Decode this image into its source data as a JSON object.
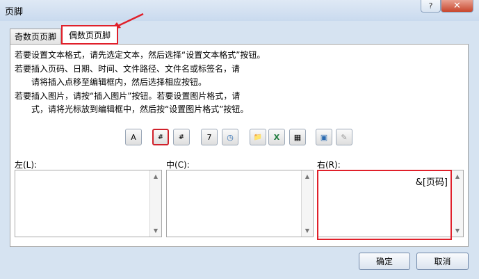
{
  "window": {
    "title": "页脚",
    "help": "?",
    "close": "✕"
  },
  "tabs": [
    {
      "label": "奇数页页脚"
    },
    {
      "label": "偶数页页脚"
    }
  ],
  "instructions": [
    "若要设置文本格式，请先选定文本，然后选择“设置文本格式”按钮。",
    "若要插入页码、日期、时间、文件路径、文件名或标签名，请",
    "请将插入点移至编辑框内，然后选择相应按钮。",
    "若要插入图片，请按“插入图片”按钮。若要设置图片格式，请",
    "式，请将光标放到编辑框中，然后按“设置图片格式”按钮。"
  ],
  "toolbar": {
    "format_text": "A",
    "page_number": "#",
    "page_count": "#",
    "date": "7",
    "time": "◷",
    "file_path": "📁",
    "file_name": "X",
    "sheet_name": "▦",
    "insert_picture": "▣",
    "format_picture": "✎"
  },
  "sections": {
    "left_label": "左(L):",
    "center_label": "中(C):",
    "right_label": "右(R):",
    "left_value": "",
    "center_value": "",
    "right_value": "&[页码]"
  },
  "buttons": {
    "ok": "确定",
    "cancel": "取消"
  },
  "colors": {
    "highlight": "#e0202a",
    "close_red": "#c8452c"
  }
}
